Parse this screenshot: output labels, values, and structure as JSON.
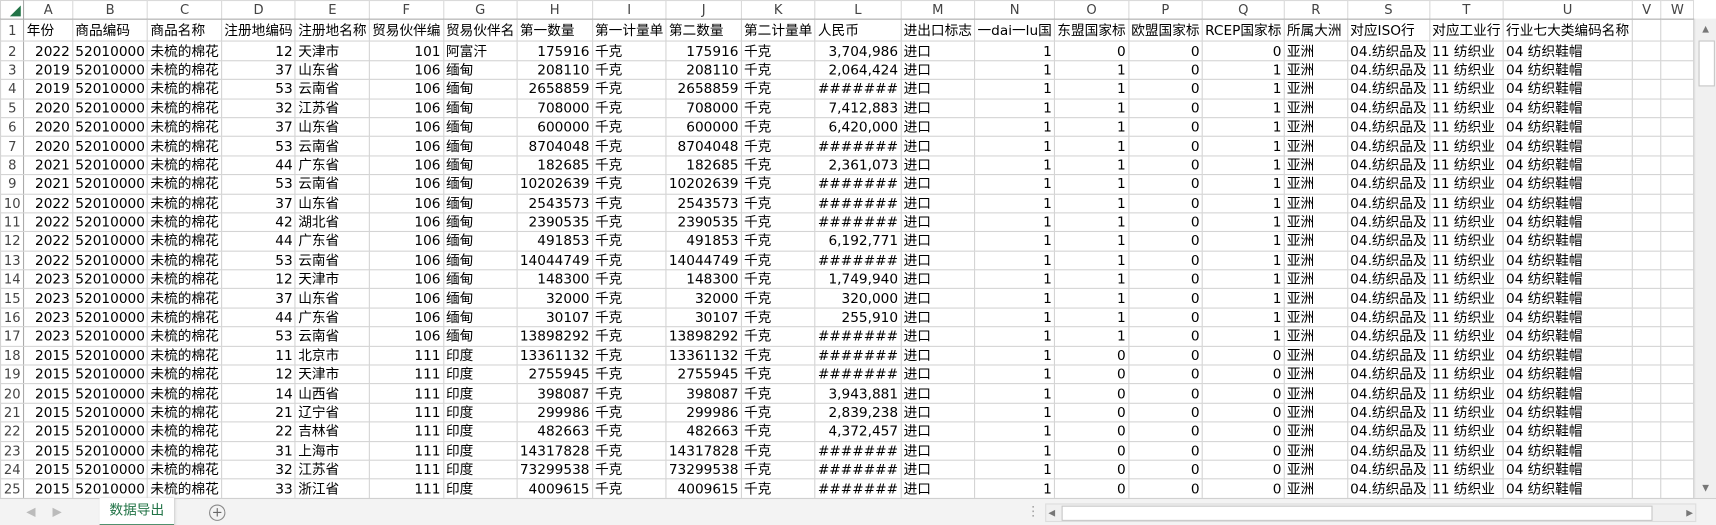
{
  "columns": [
    "A",
    "B",
    "C",
    "D",
    "E",
    "F",
    "G",
    "H",
    "I",
    "J",
    "K",
    "L",
    "M",
    "N",
    "O",
    "P",
    "Q",
    "R",
    "S",
    "T",
    "U",
    "V",
    "W"
  ],
  "headers": [
    "年份",
    "商品编码",
    "商品名称",
    "注册地编码",
    "注册地名称",
    "贸易伙伴编",
    "贸易伙伴名",
    "第一数量",
    "第一计量单",
    "第二数量",
    "第二计量单",
    "人民币",
    "进出口标志",
    "一dai一lu国",
    "东盟国家标",
    "欧盟国家标",
    "RCEP国家标",
    "所属大洲",
    "对应ISO行",
    "对应工业行",
    "行业七大类编码名称",
    "",
    ""
  ],
  "rows": [
    [
      "2022",
      "52010000",
      "未梳的棉花",
      "12",
      "天津市",
      "101",
      "阿富汗",
      "175916",
      "千克",
      "175916",
      "千克",
      "3,704,986",
      "进口",
      "1",
      "0",
      "0",
      "0",
      "亚洲",
      "04.纺织品及",
      "11 纺织业",
      "04 纺织鞋帽",
      "",
      ""
    ],
    [
      "2019",
      "52010000",
      "未梳的棉花",
      "37",
      "山东省",
      "106",
      "缅甸",
      "208110",
      "千克",
      "208110",
      "千克",
      "2,064,424",
      "进口",
      "1",
      "1",
      "0",
      "1",
      "亚洲",
      "04.纺织品及",
      "11 纺织业",
      "04 纺织鞋帽",
      "",
      ""
    ],
    [
      "2019",
      "52010000",
      "未梳的棉花",
      "53",
      "云南省",
      "106",
      "缅甸",
      "2658859",
      "千克",
      "2658859",
      "千克",
      "#######",
      "进口",
      "1",
      "1",
      "0",
      "1",
      "亚洲",
      "04.纺织品及",
      "11 纺织业",
      "04 纺织鞋帽",
      "",
      ""
    ],
    [
      "2020",
      "52010000",
      "未梳的棉花",
      "32",
      "江苏省",
      "106",
      "缅甸",
      "708000",
      "千克",
      "708000",
      "千克",
      "7,412,883",
      "进口",
      "1",
      "1",
      "0",
      "1",
      "亚洲",
      "04.纺织品及",
      "11 纺织业",
      "04 纺织鞋帽",
      "",
      ""
    ],
    [
      "2020",
      "52010000",
      "未梳的棉花",
      "37",
      "山东省",
      "106",
      "缅甸",
      "600000",
      "千克",
      "600000",
      "千克",
      "6,420,000",
      "进口",
      "1",
      "1",
      "0",
      "1",
      "亚洲",
      "04.纺织品及",
      "11 纺织业",
      "04 纺织鞋帽",
      "",
      ""
    ],
    [
      "2020",
      "52010000",
      "未梳的棉花",
      "53",
      "云南省",
      "106",
      "缅甸",
      "8704048",
      "千克",
      "8704048",
      "千克",
      "#######",
      "进口",
      "1",
      "1",
      "0",
      "1",
      "亚洲",
      "04.纺织品及",
      "11 纺织业",
      "04 纺织鞋帽",
      "",
      ""
    ],
    [
      "2021",
      "52010000",
      "未梳的棉花",
      "44",
      "广东省",
      "106",
      "缅甸",
      "182685",
      "千克",
      "182685",
      "千克",
      "2,361,073",
      "进口",
      "1",
      "1",
      "0",
      "1",
      "亚洲",
      "04.纺织品及",
      "11 纺织业",
      "04 纺织鞋帽",
      "",
      ""
    ],
    [
      "2021",
      "52010000",
      "未梳的棉花",
      "53",
      "云南省",
      "106",
      "缅甸",
      "10202639",
      "千克",
      "10202639",
      "千克",
      "#######",
      "进口",
      "1",
      "1",
      "0",
      "1",
      "亚洲",
      "04.纺织品及",
      "11 纺织业",
      "04 纺织鞋帽",
      "",
      ""
    ],
    [
      "2022",
      "52010000",
      "未梳的棉花",
      "37",
      "山东省",
      "106",
      "缅甸",
      "2543573",
      "千克",
      "2543573",
      "千克",
      "#######",
      "进口",
      "1",
      "1",
      "0",
      "1",
      "亚洲",
      "04.纺织品及",
      "11 纺织业",
      "04 纺织鞋帽",
      "",
      ""
    ],
    [
      "2022",
      "52010000",
      "未梳的棉花",
      "42",
      "湖北省",
      "106",
      "缅甸",
      "2390535",
      "千克",
      "2390535",
      "千克",
      "#######",
      "进口",
      "1",
      "1",
      "0",
      "1",
      "亚洲",
      "04.纺织品及",
      "11 纺织业",
      "04 纺织鞋帽",
      "",
      ""
    ],
    [
      "2022",
      "52010000",
      "未梳的棉花",
      "44",
      "广东省",
      "106",
      "缅甸",
      "491853",
      "千克",
      "491853",
      "千克",
      "6,192,771",
      "进口",
      "1",
      "1",
      "0",
      "1",
      "亚洲",
      "04.纺织品及",
      "11 纺织业",
      "04 纺织鞋帽",
      "",
      ""
    ],
    [
      "2022",
      "52010000",
      "未梳的棉花",
      "53",
      "云南省",
      "106",
      "缅甸",
      "14044749",
      "千克",
      "14044749",
      "千克",
      "#######",
      "进口",
      "1",
      "1",
      "0",
      "1",
      "亚洲",
      "04.纺织品及",
      "11 纺织业",
      "04 纺织鞋帽",
      "",
      ""
    ],
    [
      "2023",
      "52010000",
      "未梳的棉花",
      "12",
      "天津市",
      "106",
      "缅甸",
      "148300",
      "千克",
      "148300",
      "千克",
      "1,749,940",
      "进口",
      "1",
      "1",
      "0",
      "1",
      "亚洲",
      "04.纺织品及",
      "11 纺织业",
      "04 纺织鞋帽",
      "",
      ""
    ],
    [
      "2023",
      "52010000",
      "未梳的棉花",
      "37",
      "山东省",
      "106",
      "缅甸",
      "32000",
      "千克",
      "32000",
      "千克",
      "320,000",
      "进口",
      "1",
      "1",
      "0",
      "1",
      "亚洲",
      "04.纺织品及",
      "11 纺织业",
      "04 纺织鞋帽",
      "",
      ""
    ],
    [
      "2023",
      "52010000",
      "未梳的棉花",
      "44",
      "广东省",
      "106",
      "缅甸",
      "30107",
      "千克",
      "30107",
      "千克",
      "255,910",
      "进口",
      "1",
      "1",
      "0",
      "1",
      "亚洲",
      "04.纺织品及",
      "11 纺织业",
      "04 纺织鞋帽",
      "",
      ""
    ],
    [
      "2023",
      "52010000",
      "未梳的棉花",
      "53",
      "云南省",
      "106",
      "缅甸",
      "13898292",
      "千克",
      "13898292",
      "千克",
      "#######",
      "进口",
      "1",
      "1",
      "0",
      "1",
      "亚洲",
      "04.纺织品及",
      "11 纺织业",
      "04 纺织鞋帽",
      "",
      ""
    ],
    [
      "2015",
      "52010000",
      "未梳的棉花",
      "11",
      "北京市",
      "111",
      "印度",
      "13361132",
      "千克",
      "13361132",
      "千克",
      "#######",
      "进口",
      "1",
      "0",
      "0",
      "0",
      "亚洲",
      "04.纺织品及",
      "11 纺织业",
      "04 纺织鞋帽",
      "",
      ""
    ],
    [
      "2015",
      "52010000",
      "未梳的棉花",
      "12",
      "天津市",
      "111",
      "印度",
      "2755945",
      "千克",
      "2755945",
      "千克",
      "#######",
      "进口",
      "1",
      "0",
      "0",
      "0",
      "亚洲",
      "04.纺织品及",
      "11 纺织业",
      "04 纺织鞋帽",
      "",
      ""
    ],
    [
      "2015",
      "52010000",
      "未梳的棉花",
      "14",
      "山西省",
      "111",
      "印度",
      "398087",
      "千克",
      "398087",
      "千克",
      "3,943,881",
      "进口",
      "1",
      "0",
      "0",
      "0",
      "亚洲",
      "04.纺织品及",
      "11 纺织业",
      "04 纺织鞋帽",
      "",
      ""
    ],
    [
      "2015",
      "52010000",
      "未梳的棉花",
      "21",
      "辽宁省",
      "111",
      "印度",
      "299986",
      "千克",
      "299986",
      "千克",
      "2,839,238",
      "进口",
      "1",
      "0",
      "0",
      "0",
      "亚洲",
      "04.纺织品及",
      "11 纺织业",
      "04 纺织鞋帽",
      "",
      ""
    ],
    [
      "2015",
      "52010000",
      "未梳的棉花",
      "22",
      "吉林省",
      "111",
      "印度",
      "482663",
      "千克",
      "482663",
      "千克",
      "4,372,457",
      "进口",
      "1",
      "0",
      "0",
      "0",
      "亚洲",
      "04.纺织品及",
      "11 纺织业",
      "04 纺织鞋帽",
      "",
      ""
    ],
    [
      "2015",
      "52010000",
      "未梳的棉花",
      "31",
      "上海市",
      "111",
      "印度",
      "14317828",
      "千克",
      "14317828",
      "千克",
      "#######",
      "进口",
      "1",
      "0",
      "0",
      "0",
      "亚洲",
      "04.纺织品及",
      "11 纺织业",
      "04 纺织鞋帽",
      "",
      ""
    ],
    [
      "2015",
      "52010000",
      "未梳的棉花",
      "32",
      "江苏省",
      "111",
      "印度",
      "73299538",
      "千克",
      "73299538",
      "千克",
      "#######",
      "进口",
      "1",
      "0",
      "0",
      "0",
      "亚洲",
      "04.纺织品及",
      "11 纺织业",
      "04 纺织鞋帽",
      "",
      ""
    ],
    [
      "2015",
      "52010000",
      "未梳的棉花",
      "33",
      "浙江省",
      "111",
      "印度",
      "4009615",
      "千克",
      "4009615",
      "千克",
      "#######",
      "进口",
      "1",
      "0",
      "0",
      "0",
      "亚洲",
      "04.纺织品及",
      "11 纺织业",
      "04 纺织鞋帽",
      "",
      ""
    ]
  ],
  "numeric_columns": [
    0,
    3,
    5,
    7,
    9,
    11,
    13,
    14,
    15,
    16
  ],
  "sheet_tabs": [
    {
      "label": "数据导出",
      "active": true
    }
  ],
  "icons": {
    "add_sheet": "plus-circle-icon",
    "prev_sheet": "chevron-left-icon",
    "next_sheet": "chevron-right-icon",
    "select_all": "select-all-triangle-icon"
  },
  "colors": {
    "accent": "#217346",
    "gridline": "#d4d4d4"
  }
}
